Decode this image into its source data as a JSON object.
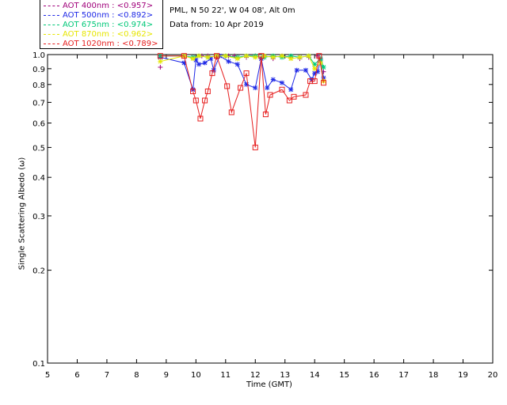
{
  "header": {
    "location": "PML, N 50 22', W 04 08', Alt 0m",
    "date_line": "Data from: 10 Apr 2019"
  },
  "legend": [
    {
      "label": "AOT  400nm : <0.957>",
      "color": "#a0007a"
    },
    {
      "label": "AOT  500nm : <0.892>",
      "color": "#1e28e6"
    },
    {
      "label": "AOT  675nm : <0.974>",
      "color": "#00c878"
    },
    {
      "label": "AOT  870nm : <0.962>",
      "color": "#e6e600"
    },
    {
      "label": "AOT 1020nm : <0.789>",
      "color": "#e61e1e"
    }
  ],
  "chart_data": {
    "type": "scatter",
    "xlabel": "Time (GMT)",
    "ylabel": "Single Scattering Albedo (ω)",
    "xlim": [
      5,
      20
    ],
    "ylim": [
      0.1,
      1.0
    ],
    "yscale": "log",
    "x_ticks": [
      5,
      6,
      7,
      8,
      9,
      10,
      11,
      12,
      13,
      14,
      15,
      16,
      17,
      18,
      19,
      20
    ],
    "y_ticks": [
      0.1,
      0.2,
      0.3,
      0.4,
      0.5,
      0.6,
      0.7,
      0.8,
      0.9,
      1.0
    ],
    "y_tick_labels": [
      "0.1",
      "0.2",
      "0.3",
      "0.4",
      "0.5",
      "0.6",
      "0.7",
      "0.8",
      "0.9",
      "1.0"
    ],
    "grid": false,
    "legend_position": "top-left",
    "series": [
      {
        "name": "AOT  400nm : <0.957>",
        "color": "#a0007a",
        "marker": "plus",
        "connected": false,
        "x": [
          8.8,
          9.6,
          9.9,
          10.2,
          10.4,
          10.7,
          11.1,
          11.3,
          11.7,
          12.0,
          12.3,
          12.6,
          12.9,
          13.2,
          13.5,
          13.8,
          14.1,
          14.3
        ],
        "y": [
          0.91,
          0.99,
          0.98,
          0.99,
          0.99,
          0.98,
          0.99,
          0.99,
          0.98,
          0.99,
          0.99,
          0.97,
          0.99,
          0.98,
          0.97,
          0.98,
          0.99,
          0.88
        ]
      },
      {
        "name": "AOT  500nm : <0.892>",
        "color": "#1e28e6",
        "marker": "asterisk",
        "connected": true,
        "x": [
          8.8,
          9.6,
          9.9,
          10.0,
          10.1,
          10.3,
          10.5,
          10.6,
          10.8,
          11.1,
          11.4,
          11.7,
          12.0,
          12.2,
          12.4,
          12.6,
          12.9,
          13.2,
          13.4,
          13.7,
          13.9,
          14.0,
          14.1,
          14.2,
          14.3
        ],
        "y": [
          0.98,
          0.94,
          0.77,
          0.96,
          0.93,
          0.94,
          0.97,
          0.89,
          0.99,
          0.95,
          0.93,
          0.8,
          0.78,
          0.97,
          0.78,
          0.83,
          0.81,
          0.77,
          0.89,
          0.89,
          0.83,
          0.87,
          0.88,
          0.96,
          0.84
        ]
      },
      {
        "name": "AOT  675nm : <0.974>",
        "color": "#00c878",
        "marker": "asterisk",
        "connected": true,
        "x": [
          8.8,
          9.6,
          9.9,
          10.1,
          10.4,
          10.7,
          11.0,
          11.4,
          11.7,
          12.0,
          12.3,
          12.6,
          12.9,
          13.2,
          13.5,
          13.8,
          14.0,
          14.2,
          14.3
        ],
        "y": [
          0.99,
          0.99,
          0.98,
          0.99,
          0.98,
          0.99,
          0.99,
          0.98,
          0.99,
          0.99,
          0.98,
          0.99,
          0.98,
          0.99,
          0.98,
          0.99,
          0.93,
          0.97,
          0.91
        ]
      },
      {
        "name": "AOT  870nm : <0.962>",
        "color": "#e6e600",
        "marker": "asterisk",
        "connected": true,
        "x": [
          8.8,
          9.6,
          9.9,
          10.1,
          10.4,
          10.7,
          11.0,
          11.4,
          11.7,
          12.0,
          12.3,
          12.6,
          12.9,
          13.2,
          13.5,
          13.8,
          14.0,
          14.2,
          14.3
        ],
        "y": [
          0.95,
          0.99,
          0.97,
          0.99,
          0.98,
          0.99,
          0.99,
          0.97,
          0.99,
          0.98,
          0.99,
          0.98,
          0.99,
          0.97,
          0.98,
          0.99,
          0.9,
          0.94,
          0.82
        ]
      },
      {
        "name": "AOT 1020nm : <0.789>",
        "color": "#e61e1e",
        "marker": "square",
        "connected": true,
        "x": [
          8.8,
          9.6,
          9.9,
          10.0,
          10.15,
          10.3,
          10.4,
          10.55,
          10.7,
          11.05,
          11.2,
          11.5,
          11.7,
          12.0,
          12.2,
          12.35,
          12.5,
          12.9,
          13.15,
          13.3,
          13.7,
          13.85,
          14.0,
          14.15,
          14.3
        ],
        "y": [
          0.99,
          0.99,
          0.76,
          0.71,
          0.62,
          0.71,
          0.76,
          0.87,
          0.99,
          0.79,
          0.65,
          0.78,
          0.87,
          0.5,
          0.99,
          0.64,
          0.74,
          0.77,
          0.71,
          0.73,
          0.74,
          0.82,
          0.82,
          0.99,
          0.81
        ]
      }
    ]
  }
}
